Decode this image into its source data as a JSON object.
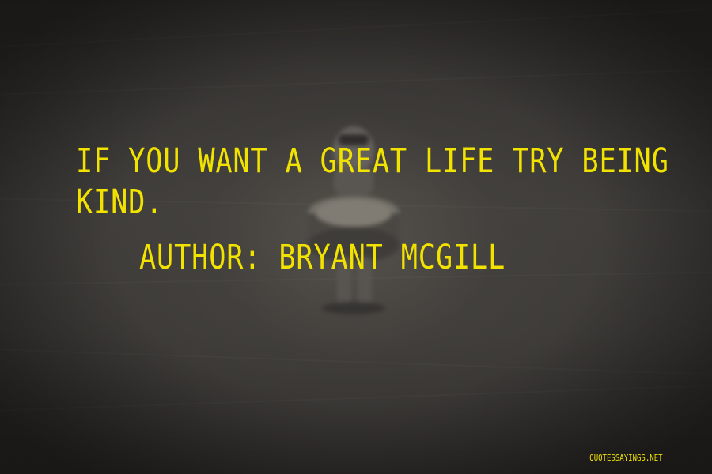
{
  "quote": {
    "lines": [
      "IF YOU WANT A GREAT LIFE TRY BEING",
      "KIND."
    ]
  },
  "author": {
    "label": "AUTHOR: BRYANT MCGILL"
  },
  "watermark": {
    "text": "QUOTESSAYINGS.NET"
  },
  "colors": {
    "text": "#f2e200",
    "background": "#3b3936"
  }
}
